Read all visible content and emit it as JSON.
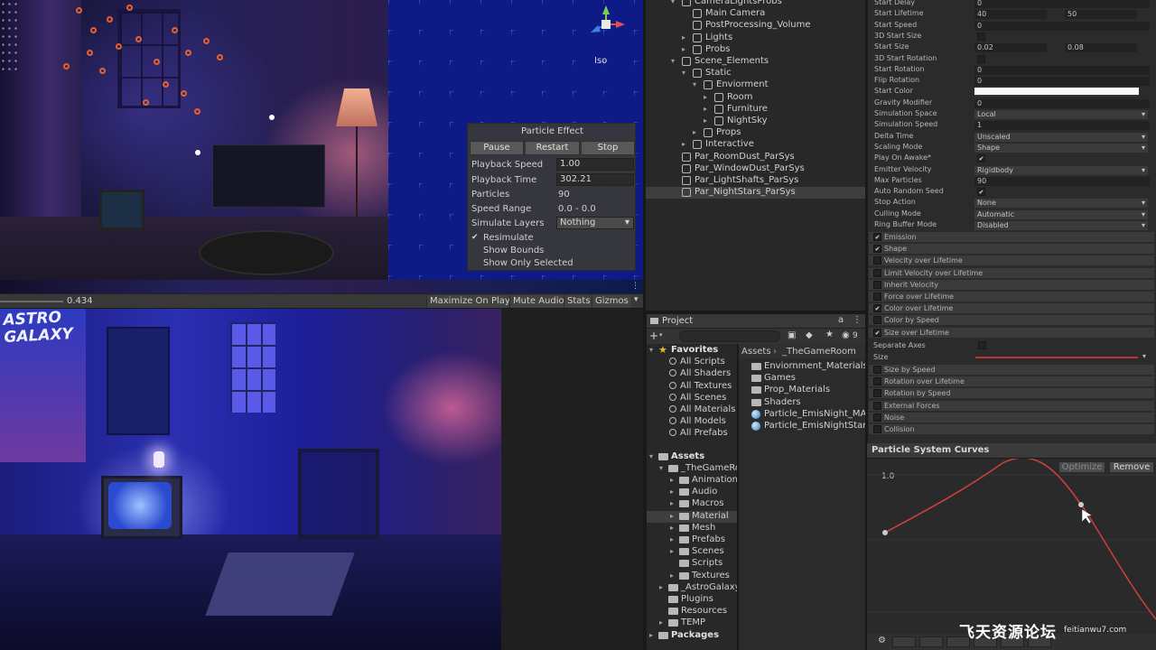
{
  "scene": {
    "iso_label": "Iso",
    "time": "0.434",
    "bar_buttons": [
      "Maximize On Play",
      "Mute Audio",
      "Stats",
      "Gizmos"
    ]
  },
  "particle_effect": {
    "title": "Particle Effect",
    "buttons": [
      "Pause",
      "Restart",
      "Stop"
    ],
    "playback_speed": {
      "label": "Playback Speed",
      "value": "1.00"
    },
    "playback_time": {
      "label": "Playback Time",
      "value": "302.21"
    },
    "particles": {
      "label": "Particles",
      "value": "90"
    },
    "speed_range": {
      "label": "Speed Range",
      "value": "0.0 - 0.0"
    },
    "simulate_layers": {
      "label": "Simulate Layers",
      "value": "Nothing"
    },
    "resimulate": {
      "label": "Resimulate",
      "checked": true
    },
    "show_bounds": {
      "label": "Show Bounds",
      "checked": false
    },
    "show_only_selected": {
      "label": "Show Only Selected",
      "checked": false
    }
  },
  "game": {
    "poster_text": "ASTRO\nGALAXY"
  },
  "hierarchy": {
    "items": [
      {
        "label": "CameraLightsProbs",
        "depth": 0,
        "arrow": "▾"
      },
      {
        "label": "Main Camera",
        "depth": 1,
        "arrow": ""
      },
      {
        "label": "PostProcessing_Volume",
        "depth": 1,
        "arrow": ""
      },
      {
        "label": "Lights",
        "depth": 1,
        "arrow": "▸"
      },
      {
        "label": "Probs",
        "depth": 1,
        "arrow": "▸"
      },
      {
        "label": "Scene_Elements",
        "depth": 0,
        "arrow": "▾"
      },
      {
        "label": "Static",
        "depth": 1,
        "arrow": "▾"
      },
      {
        "label": "Enviorment",
        "depth": 2,
        "arrow": "▾"
      },
      {
        "label": "Room",
        "depth": 3,
        "arrow": "▸"
      },
      {
        "label": "Furniture",
        "depth": 3,
        "arrow": "▸"
      },
      {
        "label": "NightSky",
        "depth": 3,
        "arrow": "▸"
      },
      {
        "label": "Props",
        "depth": 2,
        "arrow": "▸"
      },
      {
        "label": "Interactive",
        "depth": 1,
        "arrow": "▸"
      },
      {
        "label": "Par_RoomDust_ParSys",
        "depth": 0,
        "arrow": ""
      },
      {
        "label": "Par_WindowDust_ParSys",
        "depth": 0,
        "arrow": ""
      },
      {
        "label": "Par_LightShafts_ParSys",
        "depth": 0,
        "arrow": ""
      },
      {
        "label": "Par_NightStars_ParSys",
        "depth": 0,
        "arrow": "",
        "selected": true
      }
    ]
  },
  "inspector": {
    "rows": [
      {
        "label": "Start Delay",
        "type": "field",
        "value": "0"
      },
      {
        "label": "Start Lifetime",
        "type": "two",
        "value": "40",
        "value2": "50"
      },
      {
        "label": "Start Speed",
        "type": "field",
        "value": "0"
      },
      {
        "label": "3D Start Size",
        "type": "check",
        "checked": false
      },
      {
        "label": "Start Size",
        "type": "two",
        "value": "0.02",
        "value2": "0.08"
      },
      {
        "label": "3D Start Rotation",
        "type": "check",
        "checked": false
      },
      {
        "label": "Start Rotation",
        "type": "field",
        "value": "0"
      },
      {
        "label": "Flip Rotation",
        "type": "field",
        "value": "0"
      },
      {
        "label": "Start Color",
        "type": "color",
        "value": ""
      },
      {
        "label": "Gravity Modifier",
        "type": "field",
        "value": "0"
      },
      {
        "label": "Simulation Space",
        "type": "dd",
        "value": "Local"
      },
      {
        "label": "Simulation Speed",
        "type": "field",
        "value": "1"
      },
      {
        "label": "Delta Time",
        "type": "dd",
        "value": "Unscaled"
      },
      {
        "label": "Scaling Mode",
        "type": "dd",
        "value": "Shape"
      },
      {
        "label": "Play On Awake*",
        "type": "check",
        "checked": true
      },
      {
        "label": "Emitter Velocity",
        "type": "dd",
        "value": "Rigidbody"
      },
      {
        "label": "Max Particles",
        "type": "field",
        "value": "90"
      },
      {
        "label": "Auto Random Seed",
        "type": "check",
        "checked": true
      },
      {
        "label": "Stop Action",
        "type": "dd",
        "value": "None"
      },
      {
        "label": "Culling Mode",
        "type": "dd",
        "value": "Automatic"
      },
      {
        "label": "Ring Buffer Mode",
        "type": "dd",
        "value": "Disabled"
      }
    ],
    "modules": [
      {
        "label": "Emission",
        "checked": true
      },
      {
        "label": "Shape",
        "checked": true
      },
      {
        "label": "Velocity over Lifetime",
        "checked": false
      },
      {
        "label": "Limit Velocity over Lifetime",
        "checked": false
      },
      {
        "label": "Inherit Velocity",
        "checked": false
      },
      {
        "label": "Force over Lifetime",
        "checked": false
      },
      {
        "label": "Color over Lifetime",
        "checked": true
      },
      {
        "label": "Color by Speed",
        "checked": false
      },
      {
        "label": "Size over Lifetime",
        "checked": true
      }
    ],
    "separate_axes": "Separate Axes",
    "size_label": "Size",
    "modules2": [
      {
        "label": "Size by Speed",
        "checked": false
      },
      {
        "label": "Rotation over Lifetime",
        "checked": false
      },
      {
        "label": "Rotation by Speed",
        "checked": false
      },
      {
        "label": "External Forces",
        "checked": false
      },
      {
        "label": "Noise",
        "checked": false
      },
      {
        "label": "Collision",
        "checked": false
      }
    ]
  },
  "project": {
    "tab_label": "Project",
    "breadcrumb": [
      "Assets",
      "_TheGameRoom"
    ],
    "favorites_label": "Favorites",
    "favorites": [
      "All Scripts",
      "All Shaders",
      "All Textures",
      "All Scenes",
      "All Materials",
      "All Models",
      "All Prefabs"
    ],
    "assets_label": "Assets",
    "assets_tree": [
      {
        "label": "_TheGameRo",
        "depth": 1,
        "arrow": "▾"
      },
      {
        "label": "Animations",
        "depth": 2,
        "arrow": "▸"
      },
      {
        "label": "Audio",
        "depth": 2,
        "arrow": "▸"
      },
      {
        "label": "Macros",
        "depth": 2,
        "arrow": "▸"
      },
      {
        "label": "Material",
        "depth": 2,
        "arrow": "▸",
        "selected": true
      },
      {
        "label": "Mesh",
        "depth": 2,
        "arrow": "▸"
      },
      {
        "label": "Prefabs",
        "depth": 2,
        "arrow": "▸"
      },
      {
        "label": "Scenes",
        "depth": 2,
        "arrow": "▸"
      },
      {
        "label": "Scripts",
        "depth": 2,
        "arrow": ""
      },
      {
        "label": "Textures",
        "depth": 2,
        "arrow": "▸"
      },
      {
        "label": "_AstroGalaxy",
        "depth": 1,
        "arrow": "▸"
      },
      {
        "label": "Plugins",
        "depth": 1,
        "arrow": ""
      },
      {
        "label": "Resources",
        "depth": 1,
        "arrow": ""
      },
      {
        "label": "TEMP",
        "depth": 1,
        "arrow": "▸"
      }
    ],
    "packages_label": "Packages",
    "content": [
      {
        "label": "Enviornment_Materials",
        "kind": "folder"
      },
      {
        "label": "Games",
        "kind": "folder"
      },
      {
        "label": "Prop_Materials",
        "kind": "folder"
      },
      {
        "label": "Shaders",
        "kind": "folder"
      },
      {
        "label": "Particle_EmisNight_MAT",
        "kind": "material"
      },
      {
        "label": "Particle_EmisNightStars_",
        "kind": "material"
      }
    ],
    "hidden_count": "9"
  },
  "curves": {
    "title": "Particle System Curves",
    "optimize": "Optimize",
    "remove": "Remove",
    "y_label": "1.0",
    "curve_color": "#d04040"
  },
  "watermark": {
    "text": "飞天资源论坛",
    "url": "feitianwu7.com"
  }
}
